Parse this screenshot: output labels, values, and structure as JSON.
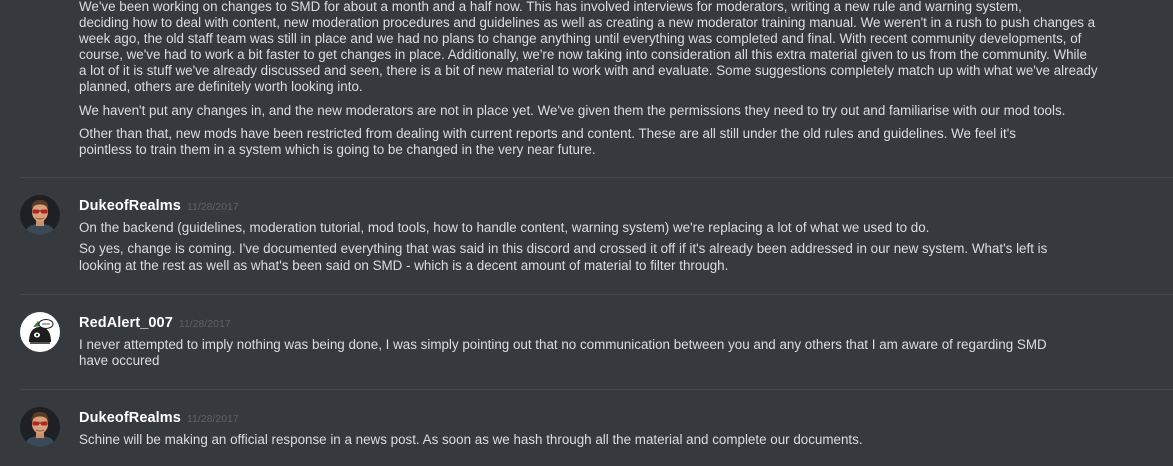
{
  "top_message": {
    "paragraphs": [
      [
        "We've been working on changes to SMD for about a month and a half now. This has involved interviews for moderators, writing a new rule and warning system,",
        "deciding how to deal with content, new moderation procedures and guidelines as well as creating a new moderator training manual. We weren't in a rush to push changes a",
        "week ago, the old staff team was still in place and we had no plans to change anything until everything was completed and final. With recent community developments, of",
        "course, we've had to work a bit faster to get changes in place. Additionally, we're now taking into consideration all this extra material given to us from the community. While",
        "a lot of it is stuff we've already discussed and seen, there is a bit of new material to work with and evaluate. Some suggestions completely match up with what we've already",
        "planned, others are definitely worth looking into."
      ],
      [
        "We haven't put any changes in, and the new moderators are not in place yet. We've given them the permissions they need to try out and familiarise with our mod tools."
      ],
      [
        "Other than that, new mods have been restricted from dealing with current reports and content. These are all still under the old rules and guidelines. We feel it's",
        "pointless to train them in a system which is going to be changed in the very near future."
      ]
    ]
  },
  "messages": [
    {
      "username": "DukeofRealms",
      "timestamp": "11/28/2017",
      "paragraphs": [
        [
          "On the backend (guidelines, moderation tutorial, mod tools, how to handle content, warning system) we're replacing a lot of what we used to do."
        ],
        [
          "So yes, change is coming. I've documented everything that was said in this discord and crossed it off if it's already been addressed in our new system. What's left is",
          "looking at the rest as well as what's been said on SMD - which is a decent amount of material to filter through."
        ]
      ]
    },
    {
      "username": "RedAlert_007",
      "timestamp": "11/28/2017",
      "paragraphs": [
        [
          "I never attempted to imply nothing was being done, I was simply pointing out that no communication between you and any others that I am aware of regarding SMD",
          "have occured"
        ]
      ]
    },
    {
      "username": "DukeofRealms",
      "timestamp": "11/28/2017",
      "paragraphs": [
        [
          "Schine will be making an official response in a news post. As soon as we hash through all the material and complete our documents."
        ]
      ]
    }
  ],
  "colors": {
    "background": "#36393e",
    "text": "#dcddde",
    "username": "#ffffff",
    "timestamp": "#5f6166",
    "divider": "#42454a"
  },
  "icons": {
    "avatar_duke": "man-with-sunglasses-avatar",
    "avatar_redalert": "cartoon-character-avatar"
  }
}
